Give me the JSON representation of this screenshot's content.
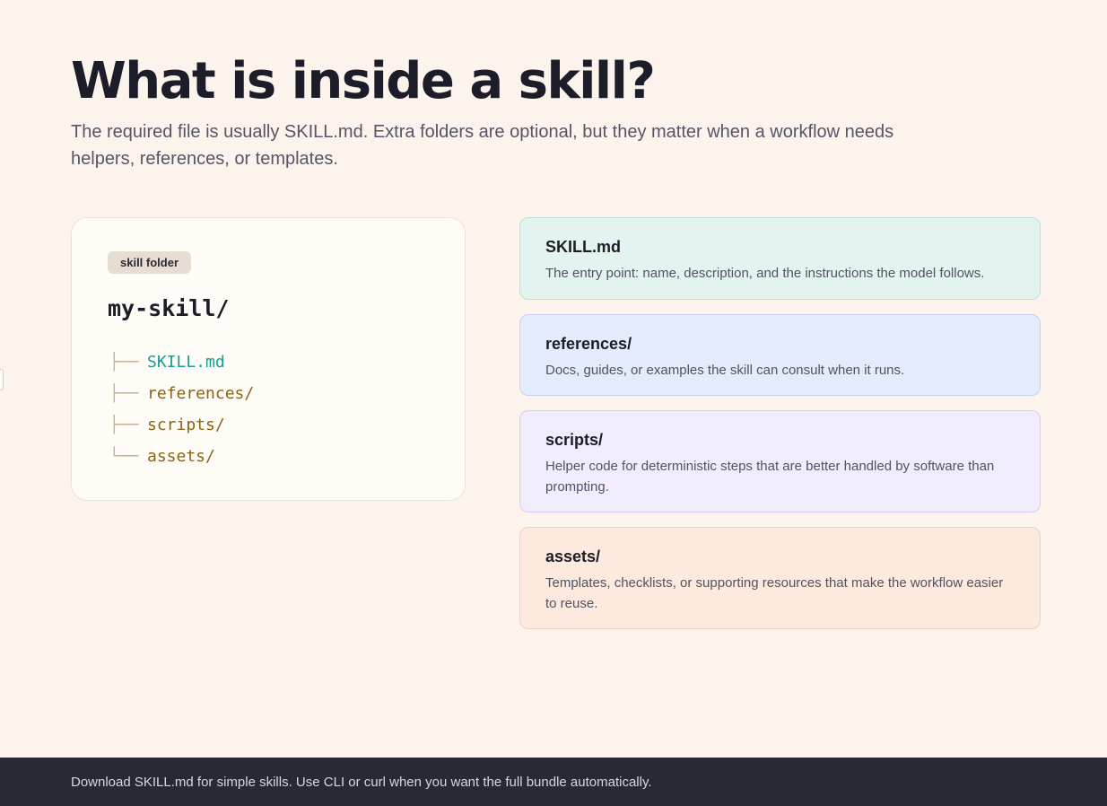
{
  "header": {
    "title": "What is inside a skill?",
    "subtitle": "The required file is usually SKILL.md. Extra folders are optional, but they matter when a workflow needs helpers, references, or templates."
  },
  "folder": {
    "badge": "skill folder",
    "name": "my-skill/",
    "tree": [
      {
        "branch": "├──",
        "label": "SKILL.md"
      },
      {
        "branch": "├──",
        "label": "references/"
      },
      {
        "branch": "├──",
        "label": "scripts/"
      },
      {
        "branch": "└──",
        "label": "assets/"
      }
    ]
  },
  "cards": [
    {
      "title": "SKILL.md",
      "description": "The entry point: name, description, and the instructions the model follows."
    },
    {
      "title": "references/",
      "description": "Docs, guides, or examples the skill can consult when it runs."
    },
    {
      "title": "scripts/",
      "description": "Helper code for deterministic steps that are better handled by software than prompting."
    },
    {
      "title": "assets/",
      "description": "Templates, checklists, or supporting resources that make the workflow easier to reuse."
    }
  ],
  "footer": {
    "text": "Download SKILL.md for simple skills. Use CLI or curl when you want the full bundle automatically."
  },
  "colors": {
    "background": "#fcf3ed",
    "skill_file": "#1d9e8c",
    "directory": "#8a6410",
    "footer": "#282935"
  }
}
